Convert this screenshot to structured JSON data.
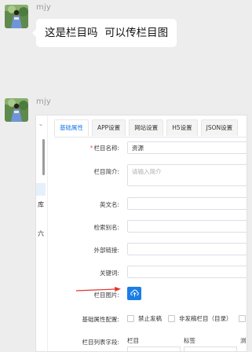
{
  "messages": [
    {
      "username": "mjy",
      "text": "这是栏目吗  可以传栏目图"
    },
    {
      "username": "mjy"
    }
  ],
  "screenshot": {
    "tabs": [
      "基础属性",
      "APP设置",
      "网站设置",
      "H5设置",
      "JSON设置"
    ],
    "active_tab": 0,
    "left_fragments": [
      "库",
      "六"
    ],
    "fields": {
      "name_label": "栏目名称:",
      "name_value": "资源",
      "intro_label": "栏目简介:",
      "intro_placeholder": "请输入简介",
      "english_label": "英文名:",
      "alias_label": "检索别名:",
      "external_label": "外部链接:",
      "keywords_label": "关键词:",
      "image_label": "栏目图片:",
      "config_label": "基础属性配置:",
      "list_fields_label": "栏目列表字段:"
    },
    "config_options": [
      "禁止发稿",
      "非发稿栏目（目录）",
      "不允"
    ],
    "list_columns": [
      "栏目",
      "标签",
      "浏"
    ],
    "accent_color": "#1b7de6",
    "arrow_color": "#e5322d"
  }
}
